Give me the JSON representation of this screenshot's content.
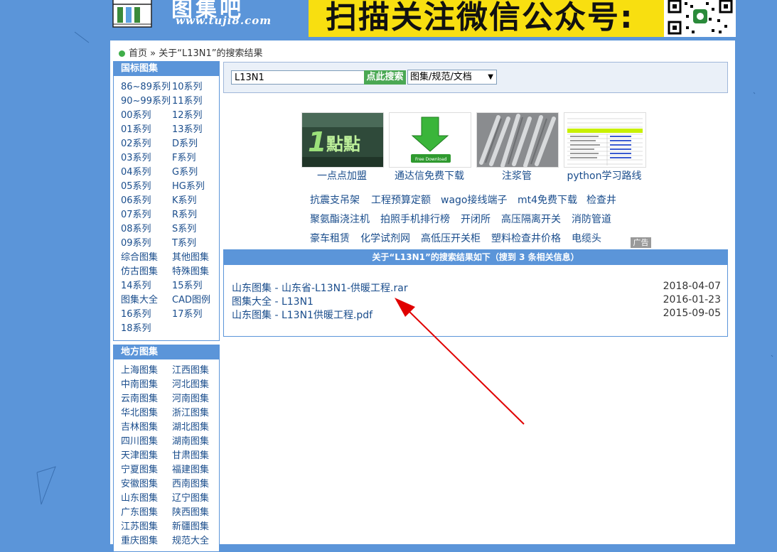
{
  "header": {
    "brand_text": "图集吧",
    "url_text": "www.tuji8.com",
    "banner_text": "扫描关注微信公众号:",
    "banner_color": "#f8df10"
  },
  "breadcrumb": {
    "home": "首页",
    "separator": " » ",
    "current": "关于“L13N1”的搜索结果"
  },
  "sidebar": {
    "national": {
      "title": "国标图集",
      "items": [
        "86~89系列",
        "10系列",
        "90~99系列",
        "11系列",
        "00系列",
        "12系列",
        "01系列",
        "13系列",
        "02系列",
        "D系列",
        "03系列",
        "F系列",
        "04系列",
        "G系列",
        "05系列",
        "HG系列",
        "06系列",
        "K系列",
        "07系列",
        "R系列",
        "08系列",
        "S系列",
        "09系列",
        "T系列",
        "综合图集",
        "其他图集",
        "仿古图集",
        "特殊图集",
        "14系列",
        "15系列",
        "图集大全",
        "CAD图例",
        "16系列",
        "17系列",
        "18系列"
      ]
    },
    "local": {
      "title": "地方图集",
      "items": [
        "上海图集",
        "江西图集",
        "中南图集",
        "河北图集",
        "云南图集",
        "河南图集",
        "华北图集",
        "浙江图集",
        "吉林图集",
        "湖北图集",
        "四川图集",
        "湖南图集",
        "天津图集",
        "甘肃图集",
        "宁夏图集",
        "福建图集",
        "安徽图集",
        "西南图集",
        "山东图集",
        "辽宁图集",
        "广东图集",
        "陕西图集",
        "江苏图集",
        "新疆图集",
        "重庆图集",
        "规范大全"
      ]
    }
  },
  "search": {
    "query": "L13N1",
    "button_label": "点此搜索",
    "select_value": "图集/规范/文档"
  },
  "ads": {
    "images": [
      {
        "caption": "一点点加盟",
        "icon": "brand-sign-image"
      },
      {
        "caption": "通达信免费下载",
        "icon": "download-arrow-image"
      },
      {
        "caption": "注浆管",
        "icon": "steel-pipes-image"
      },
      {
        "caption": "python学习路线",
        "icon": "spreadsheet-image"
      }
    ],
    "links_row1": [
      "抗震支吊架",
      "工程预算定额",
      "wago接线端子",
      "mt4免费下载",
      "检查井"
    ],
    "links_row2": [
      "聚氨酯浇注机",
      "拍照手机排行榜",
      "开闭所",
      "高压隔离开关",
      "消防管道"
    ],
    "links_row3": [
      "豪车租赁",
      "化学试剂网",
      "高低压开关柜",
      "塑料检查井价格",
      "电缆头"
    ],
    "badge": "广告"
  },
  "results": {
    "header": "关于“L13N1”的搜索结果如下（搜到 3 条相关信息）",
    "items": [
      {
        "title": "山东图集 - 山东省-L13N1-供暖工程.rar",
        "date": "2018-04-07"
      },
      {
        "title": "图集大全 - L13N1",
        "date": "2016-01-23"
      },
      {
        "title": "山东图集 - L13N1供暖工程.pdf",
        "date": "2015-09-05"
      }
    ]
  },
  "colors": {
    "page_bg": "#5b95d9",
    "link": "#1a4d8c",
    "search_button": "#4aa853",
    "annotation_arrow": "#e00000"
  }
}
